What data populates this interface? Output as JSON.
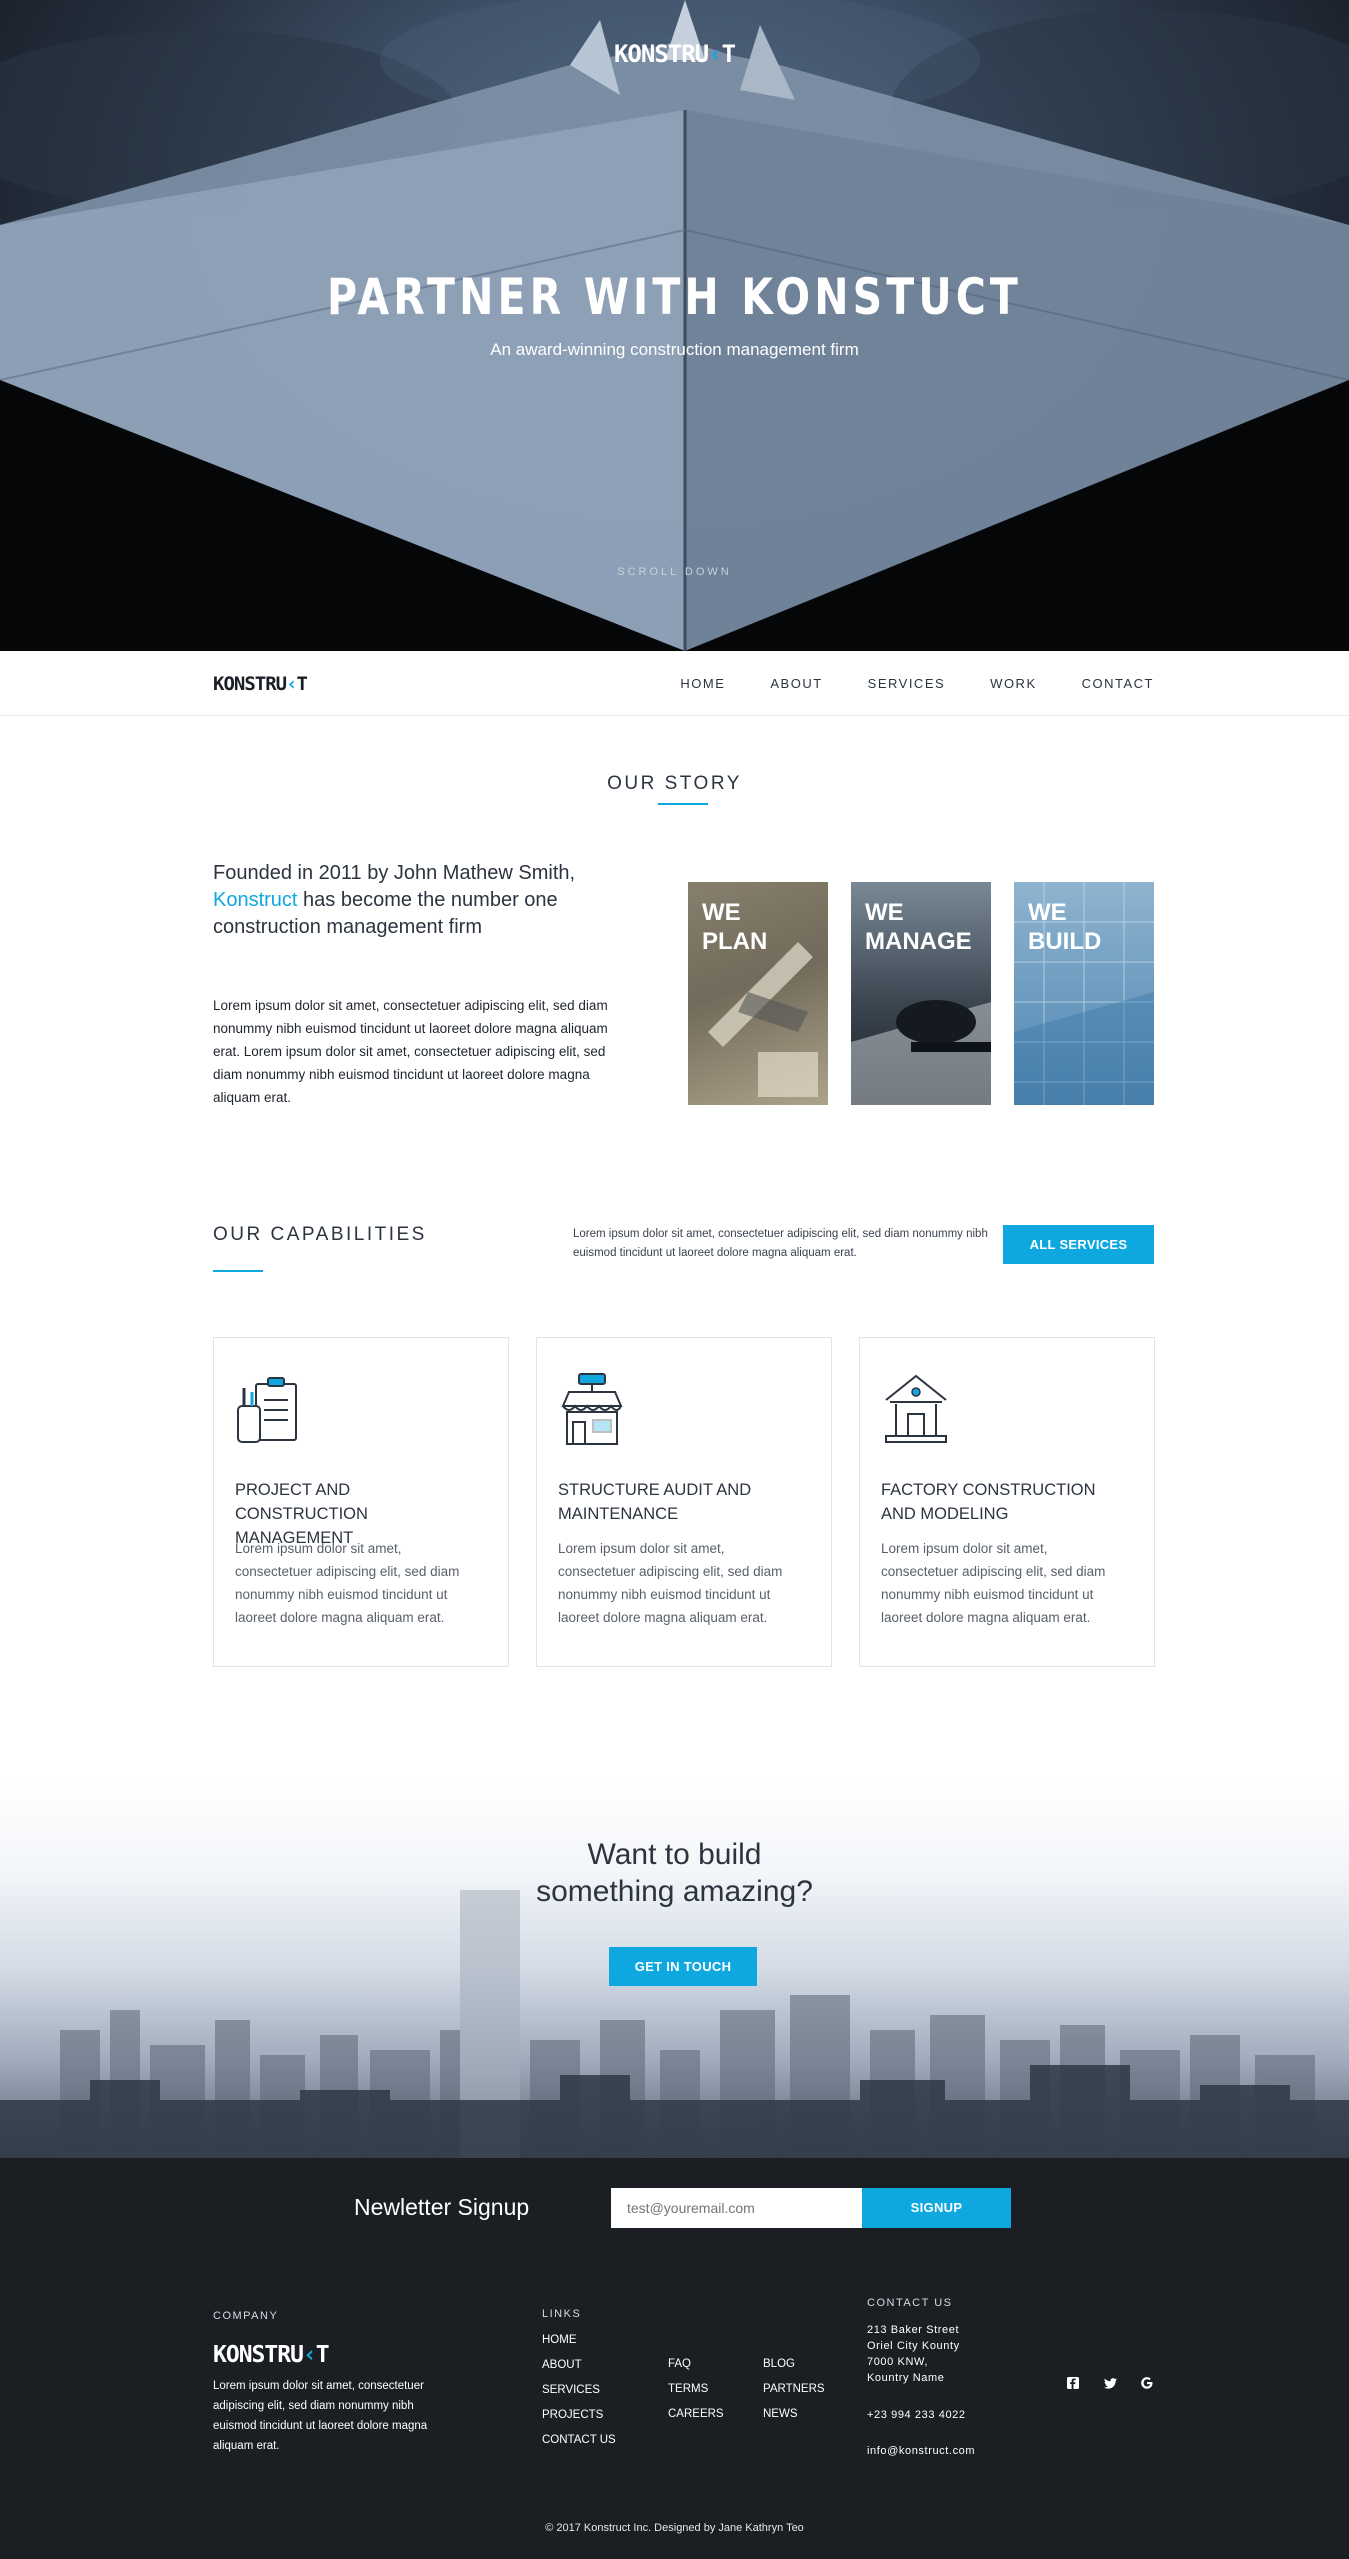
{
  "brand": {
    "logo_main": "KONSTRU",
    "logo_accent": "‹",
    "logo_tail": "T",
    "accent_color": "#0ea7e0"
  },
  "hero": {
    "title": "PARTNER WITH KONSTUCT",
    "subtitle": "An award-winning construction management firm",
    "scroll_label": "SCROLL DOWN"
  },
  "nav": {
    "items": [
      "HOME",
      "ABOUT",
      "SERVICES",
      "WORK",
      "CONTACT"
    ]
  },
  "story": {
    "title": "OUR STORY",
    "lead_before": "Founded in 2011 by John Mathew Smith, ",
    "lead_highlight": "Konstruct",
    "lead_after": " has become the number one construction management firm",
    "body": "Lorem ipsum dolor sit amet, consectetuer adipiscing elit, sed diam nonummy nibh euismod tincidunt ut laoreet dolore magna aliquam erat. Lorem ipsum dolor sit amet, consectetuer adipiscing elit, sed diam nonummy nibh euismod tincidunt ut laoreet dolore magna aliquam erat.",
    "tiles": [
      {
        "line1": "WE",
        "line2": "PLAN"
      },
      {
        "line1": "WE",
        "line2": "MANAGE"
      },
      {
        "line1": "WE",
        "line2": "BUILD"
      }
    ]
  },
  "capabilities": {
    "title": "OUR CAPABILITIES",
    "description": "Lorem ipsum dolor sit amet, consectetuer adipiscing elit, sed diam nonummy nibh euismod tincidunt ut laoreet dolore magna aliquam erat.",
    "button": "ALL SERVICES",
    "cards": [
      {
        "icon": "clipboard-tools-icon",
        "title": "PROJECT AND CONSTRUCTION MANAGEMENT",
        "text": "Lorem ipsum dolor sit amet, consectetuer adipiscing elit, sed diam nonummy nibh euismod tincidunt ut laoreet dolore magna aliquam erat."
      },
      {
        "icon": "storefront-icon",
        "title": "STRUCTURE AUDIT AND MAINTENANCE",
        "text": "Lorem ipsum dolor sit amet, consectetuer adipiscing elit, sed diam nonummy nibh euismod tincidunt ut laoreet dolore magna aliquam erat."
      },
      {
        "icon": "house-building-icon",
        "title": "FACTORY CONSTRUCTION AND MODELING",
        "text": "Lorem ipsum dolor sit amet, consectetuer adipiscing elit, sed diam nonummy nibh euismod tincidunt ut laoreet dolore magna aliquam erat."
      }
    ]
  },
  "cta": {
    "line1": "Want to build",
    "line2": "something amazing?",
    "button": "GET IN TOUCH"
  },
  "newsletter": {
    "label": "Newletter Signup",
    "placeholder": "test@youremail.com",
    "button": "SIGNUP"
  },
  "footer": {
    "company_head": "COMPANY",
    "company_text": "Lorem ipsum dolor sit amet, consectetuer adipiscing elit, sed diam nonummy nibh euismod tincidunt ut laoreet dolore magna aliquam erat.",
    "links_head": "LINKS",
    "links_col1": [
      "HOME",
      "ABOUT",
      "SERVICES",
      "PROJECTS",
      "CONTACT US"
    ],
    "links_col2": [
      "FAQ",
      "TERMS",
      "CAREERS"
    ],
    "links_col3": [
      "BLOG",
      "PARTNERS",
      "NEWS"
    ],
    "contact_head": "CONTACT US",
    "address": [
      "213 Baker Street",
      "Oriel City Kounty",
      "7000 KNW,",
      "Kountry Name"
    ],
    "phone": "+23 994 233 4022",
    "email": "info@konstruct.com",
    "social": [
      "facebook-icon",
      "twitter-icon",
      "google-icon"
    ],
    "copyright": "© 2017 Konstruct Inc. Designed by Jane Kathryn Teo"
  }
}
